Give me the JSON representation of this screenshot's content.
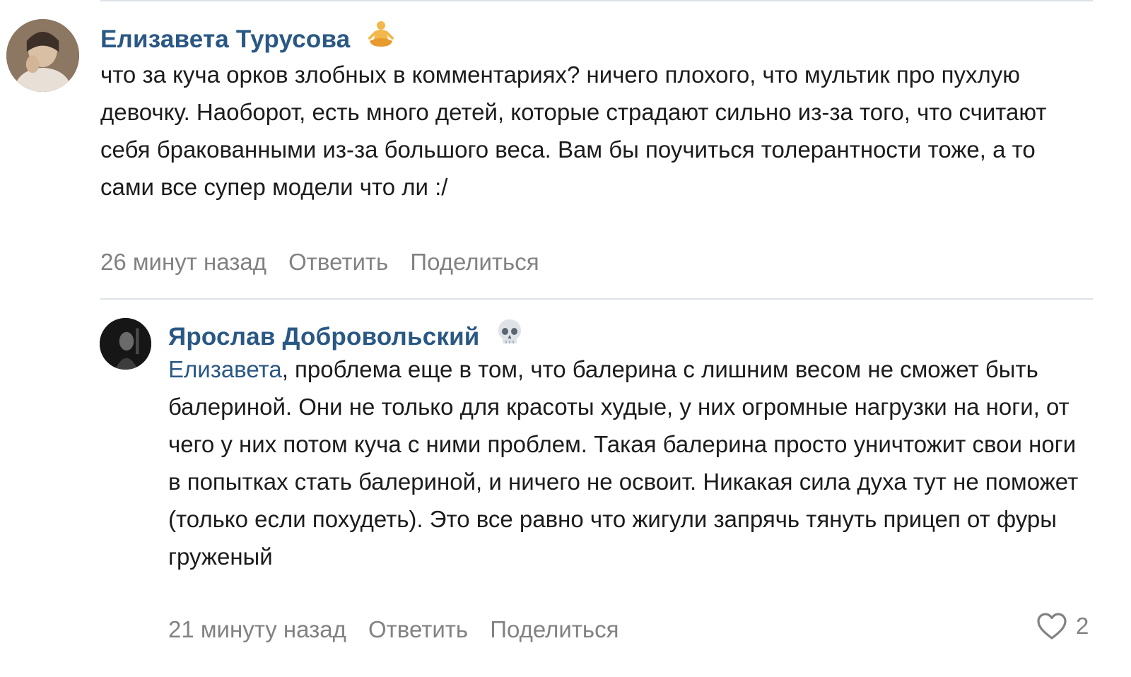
{
  "comments": [
    {
      "author": "Елизавета Турусова",
      "author_badge_icon": "meditation-emoji",
      "text": "что за куча орков злобных в комментариях? ничего плохого, что мультик про пухлую девочку. Наоборот, есть много детей, которые страдают сильно из-за того, что считают себя бракованными из-за большого веса. Вам бы поучиться толерантности тоже, а то сами все супер модели что ли :/",
      "time": "26 минут назад",
      "reply_label": "Ответить",
      "share_label": "Поделиться"
    },
    {
      "author": "Ярослав Добровольский",
      "author_badge_icon": "skull-emoji",
      "mention": "Елизавета",
      "text": ", проблема еще в том, что балерина с лишним весом не сможет быть балериной. Они не только для красоты худые, у них огромные нагрузки на ноги, от чего у них потом куча с ними проблем. Такая балерина просто уничтожит свои ноги в попытках стать балериной, и ничего не освоит. Никакая сила духа тут не поможет (только если похудеть). Это все равно что жигули запрячь тянуть прицеп от фуры груженый",
      "time": "21 минуту назад",
      "reply_label": "Ответить",
      "share_label": "Поделиться",
      "likes": "2",
      "like_icon": "heart-outline-icon"
    }
  ],
  "colors": {
    "author": "#2a5885",
    "text": "#1c1c1c",
    "meta": "#828282",
    "divider": "#dce1e6"
  }
}
